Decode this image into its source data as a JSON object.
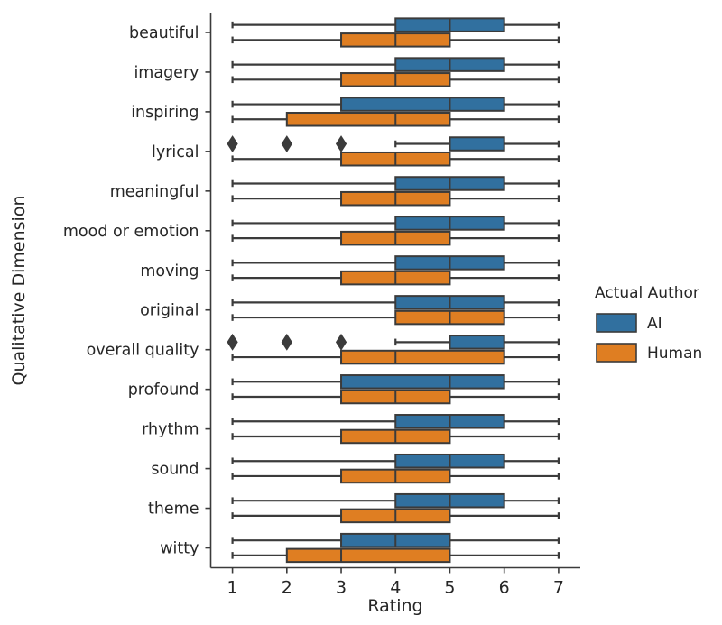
{
  "chart_data": {
    "type": "box",
    "title": "",
    "xlabel": "Rating",
    "ylabel": "Qualitative Dimension",
    "orientation": "horizontal",
    "xlim": [
      0.6,
      7.4
    ],
    "xticks": [
      1,
      2,
      3,
      4,
      5,
      6,
      7
    ],
    "xticklabels": [
      "1",
      "2",
      "3",
      "4",
      "5",
      "6",
      "7"
    ],
    "grid": false,
    "legend": {
      "title": "Actual Author",
      "position": "right",
      "entries": [
        {
          "label": "AI",
          "color": "#31709f"
        },
        {
          "label": "Human",
          "color": "#df7e22"
        }
      ]
    },
    "categories": [
      "beautiful",
      "imagery",
      "inspiring",
      "lyrical",
      "meaningful",
      "mood or emotion",
      "moving",
      "original",
      "overall quality",
      "profound",
      "rhythm",
      "sound",
      "theme",
      "witty"
    ],
    "series": [
      {
        "name": "AI",
        "color": "#31709f",
        "boxes": [
          {
            "category": "beautiful",
            "whisker_low": 1,
            "q1": 4,
            "median": 5,
            "q3": 6,
            "whisker_high": 7,
            "outliers": []
          },
          {
            "category": "imagery",
            "whisker_low": 1,
            "q1": 4,
            "median": 5,
            "q3": 6,
            "whisker_high": 7,
            "outliers": []
          },
          {
            "category": "inspiring",
            "whisker_low": 1,
            "q1": 3,
            "median": 5,
            "q3": 6,
            "whisker_high": 7,
            "outliers": []
          },
          {
            "category": "lyrical",
            "whisker_low": 4,
            "q1": 5,
            "median": 5,
            "q3": 6,
            "whisker_high": 7,
            "outliers": [
              1,
              2,
              3
            ]
          },
          {
            "category": "meaningful",
            "whisker_low": 1,
            "q1": 4,
            "median": 5,
            "q3": 6,
            "whisker_high": 7,
            "outliers": []
          },
          {
            "category": "mood or emotion",
            "whisker_low": 1,
            "q1": 4,
            "median": 5,
            "q3": 6,
            "whisker_high": 7,
            "outliers": []
          },
          {
            "category": "moving",
            "whisker_low": 1,
            "q1": 4,
            "median": 5,
            "q3": 6,
            "whisker_high": 7,
            "outliers": []
          },
          {
            "category": "original",
            "whisker_low": 1,
            "q1": 4,
            "median": 5,
            "q3": 6,
            "whisker_high": 7,
            "outliers": []
          },
          {
            "category": "overall quality",
            "whisker_low": 4,
            "q1": 5,
            "median": 5,
            "q3": 6,
            "whisker_high": 7,
            "outliers": [
              1,
              2,
              3
            ]
          },
          {
            "category": "profound",
            "whisker_low": 1,
            "q1": 3,
            "median": 5,
            "q3": 6,
            "whisker_high": 7,
            "outliers": []
          },
          {
            "category": "rhythm",
            "whisker_low": 1,
            "q1": 4,
            "median": 5,
            "q3": 6,
            "whisker_high": 7,
            "outliers": []
          },
          {
            "category": "sound",
            "whisker_low": 1,
            "q1": 4,
            "median": 5,
            "q3": 6,
            "whisker_high": 7,
            "outliers": []
          },
          {
            "category": "theme",
            "whisker_low": 1,
            "q1": 4,
            "median": 5,
            "q3": 6,
            "whisker_high": 7,
            "outliers": []
          },
          {
            "category": "witty",
            "whisker_low": 1,
            "q1": 3,
            "median": 4,
            "q3": 5,
            "whisker_high": 7,
            "outliers": []
          }
        ]
      },
      {
        "name": "Human",
        "color": "#df7e22",
        "boxes": [
          {
            "category": "beautiful",
            "whisker_low": 1,
            "q1": 3,
            "median": 4,
            "q3": 5,
            "whisker_high": 7,
            "outliers": []
          },
          {
            "category": "imagery",
            "whisker_low": 1,
            "q1": 3,
            "median": 4,
            "q3": 5,
            "whisker_high": 7,
            "outliers": []
          },
          {
            "category": "inspiring",
            "whisker_low": 1,
            "q1": 2,
            "median": 4,
            "q3": 5,
            "whisker_high": 7,
            "outliers": []
          },
          {
            "category": "lyrical",
            "whisker_low": 1,
            "q1": 3,
            "median": 4,
            "q3": 5,
            "whisker_high": 7,
            "outliers": []
          },
          {
            "category": "meaningful",
            "whisker_low": 1,
            "q1": 3,
            "median": 4,
            "q3": 5,
            "whisker_high": 7,
            "outliers": []
          },
          {
            "category": "mood or emotion",
            "whisker_low": 1,
            "q1": 3,
            "median": 4,
            "q3": 5,
            "whisker_high": 7,
            "outliers": []
          },
          {
            "category": "moving",
            "whisker_low": 1,
            "q1": 3,
            "median": 4,
            "q3": 5,
            "whisker_high": 7,
            "outliers": []
          },
          {
            "category": "original",
            "whisker_low": 1,
            "q1": 4,
            "median": 5,
            "q3": 6,
            "whisker_high": 7,
            "outliers": []
          },
          {
            "category": "overall quality",
            "whisker_low": 1,
            "q1": 3,
            "median": 4,
            "q3": 6,
            "whisker_high": 7,
            "outliers": []
          },
          {
            "category": "profound",
            "whisker_low": 1,
            "q1": 3,
            "median": 4,
            "q3": 5,
            "whisker_high": 7,
            "outliers": []
          },
          {
            "category": "rhythm",
            "whisker_low": 1,
            "q1": 3,
            "median": 4,
            "q3": 5,
            "whisker_high": 7,
            "outliers": []
          },
          {
            "category": "sound",
            "whisker_low": 1,
            "q1": 3,
            "median": 4,
            "q3": 5,
            "whisker_high": 7,
            "outliers": []
          },
          {
            "category": "theme",
            "whisker_low": 1,
            "q1": 3,
            "median": 4,
            "q3": 5,
            "whisker_high": 7,
            "outliers": []
          },
          {
            "category": "witty",
            "whisker_low": 1,
            "q1": 2,
            "median": 3,
            "q3": 5,
            "whisker_high": 7,
            "outliers": []
          }
        ]
      }
    ]
  }
}
